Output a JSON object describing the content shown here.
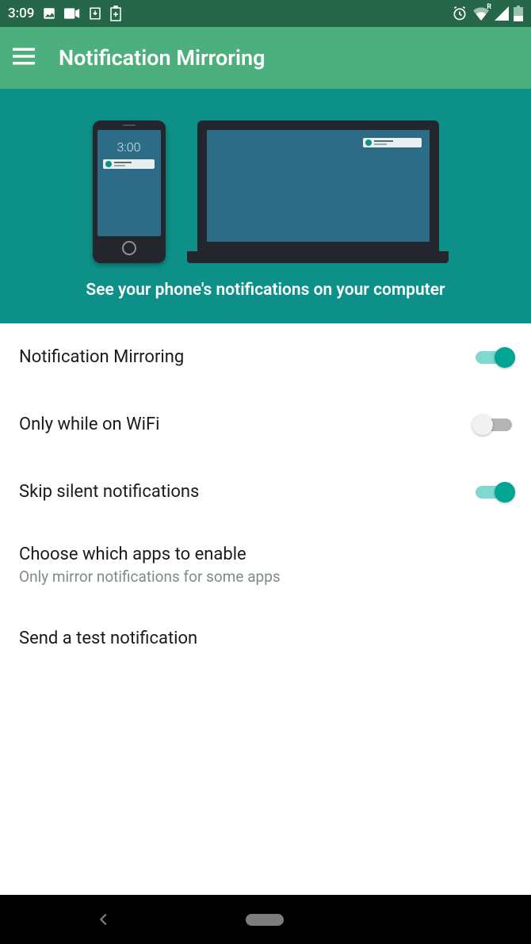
{
  "status": {
    "time": "3:09",
    "alt_indicator": "R"
  },
  "appbar": {
    "title": "Notification Mirroring"
  },
  "hero": {
    "phone_time": "3:00",
    "tagline": "See your phone's notifications on your computer"
  },
  "settings": {
    "items": [
      {
        "title": "Notification Mirroring",
        "sub": "",
        "switch": "on"
      },
      {
        "title": "Only while on WiFi",
        "sub": "",
        "switch": "off"
      },
      {
        "title": "Skip silent notifications",
        "sub": "",
        "switch": "on"
      },
      {
        "title": "Choose which apps to enable",
        "sub": "Only mirror notifications for some apps",
        "switch": ""
      },
      {
        "title": "Send a test notification",
        "sub": "",
        "switch": ""
      }
    ]
  }
}
